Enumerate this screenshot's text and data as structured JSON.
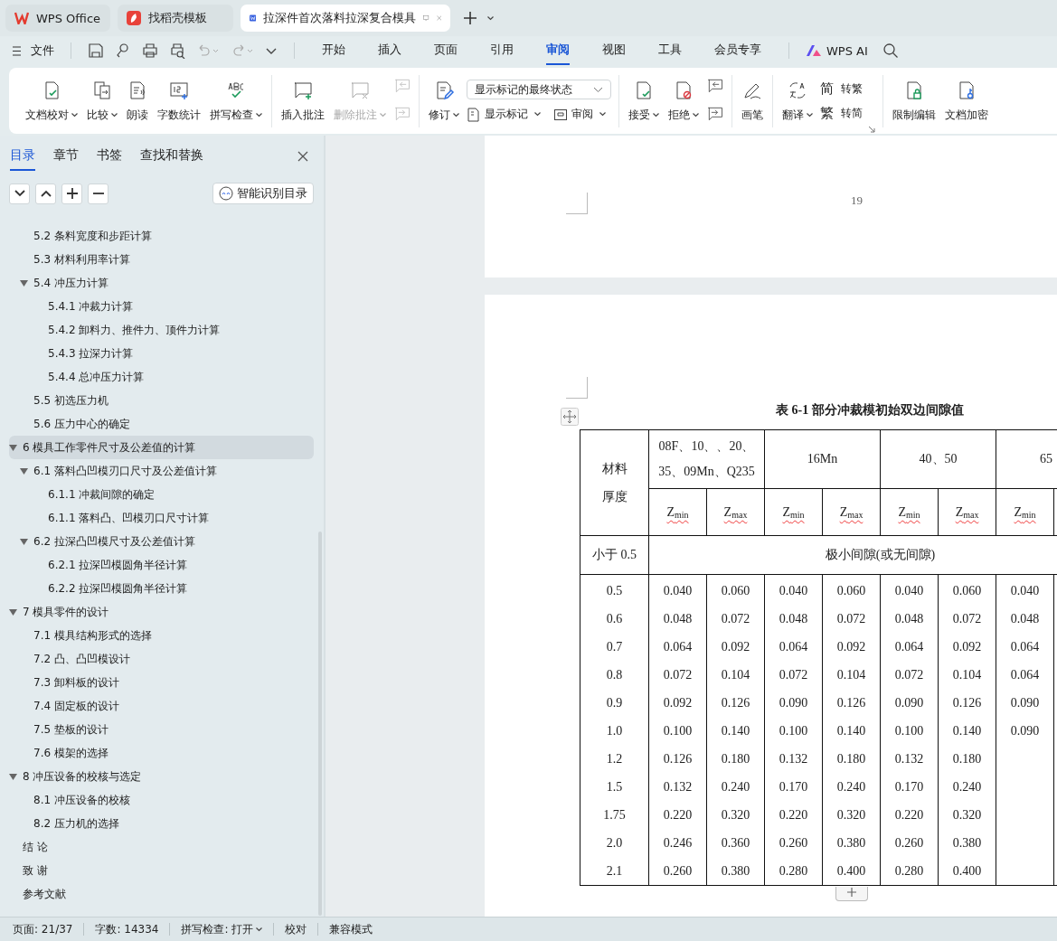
{
  "title_tabs": [
    {
      "label": "WPS Office",
      "kind": "wps",
      "selected": false,
      "closable": false
    },
    {
      "label": "找稻壳模板",
      "kind": "docer",
      "selected": false,
      "closable": false
    },
    {
      "label": "拉深件首次落料拉深复合模具",
      "kind": "doc",
      "selected": true,
      "closable": true
    }
  ],
  "file_menu": "文件",
  "menu_tabs": [
    {
      "label": "开始",
      "selected": false
    },
    {
      "label": "插入",
      "selected": false
    },
    {
      "label": "页面",
      "selected": false
    },
    {
      "label": "引用",
      "selected": false
    },
    {
      "label": "审阅",
      "selected": true
    },
    {
      "label": "视图",
      "selected": false
    },
    {
      "label": "工具",
      "selected": false
    },
    {
      "label": "会员专享",
      "selected": false
    }
  ],
  "ai_button": "WPS AI",
  "ribbon": [
    {
      "items": [
        {
          "kind": "big",
          "label": "文档校对",
          "dropdown": true,
          "disabled": false
        },
        {
          "kind": "big",
          "label": "比较",
          "dropdown": true,
          "disabled": false
        },
        {
          "kind": "big",
          "label": "朗读",
          "dropdown": false,
          "disabled": false
        },
        {
          "kind": "big",
          "label": "字数统计",
          "dropdown": false,
          "disabled": false
        },
        {
          "kind": "big",
          "label": "拼写检查",
          "dropdown": true,
          "disabled": false
        }
      ]
    },
    {
      "items": [
        {
          "kind": "big",
          "label": "插入批注",
          "dropdown": false,
          "disabled": false
        },
        {
          "kind": "big",
          "label": "删除批注",
          "dropdown": true,
          "disabled": true
        },
        {
          "kind": "icon-stack",
          "disabled": true
        }
      ]
    },
    {
      "items": [
        {
          "kind": "big",
          "label": "修订",
          "dropdown": true,
          "disabled": false
        },
        {
          "kind": "select-stack",
          "select": "显示标记的最终状态",
          "buttons": [
            {
              "label": "显示标记",
              "dropdown": true
            },
            {
              "label": "审阅",
              "dropdown": true
            }
          ]
        }
      ]
    },
    {
      "items": [
        {
          "kind": "big",
          "label": "接受",
          "dropdown": true,
          "disabled": false
        },
        {
          "kind": "big",
          "label": "拒绝",
          "dropdown": true,
          "disabled": false
        },
        {
          "kind": "icon-stack",
          "disabled": false
        }
      ]
    },
    {
      "items": [
        {
          "kind": "big",
          "label": "画笔",
          "dropdown": false,
          "disabled": false
        }
      ]
    },
    {
      "items": [
        {
          "kind": "big",
          "label": "翻译",
          "dropdown": true,
          "disabled": false
        },
        {
          "kind": "text-stack",
          "buttons": [
            {
              "glyph": "简",
              "label": "转繁"
            },
            {
              "glyph": "繁",
              "label": "转简"
            }
          ]
        }
      ]
    },
    {
      "items": [
        {
          "kind": "big",
          "label": "限制编辑",
          "dropdown": false,
          "disabled": false
        },
        {
          "kind": "big",
          "label": "文档加密",
          "dropdown": false,
          "disabled": false
        }
      ]
    }
  ],
  "sidebar": {
    "tabs": [
      {
        "label": "目录",
        "selected": true
      },
      {
        "label": "章节",
        "selected": false
      },
      {
        "label": "书签",
        "selected": false
      },
      {
        "label": "查找和替换",
        "selected": false
      }
    ],
    "smart_button": "智能识别目录",
    "outline": [
      {
        "children": [
          {
            "label": "5.2  条料宽度和步距计算",
            "selected": false
          },
          {
            "label": "5.3  材料利用率计算",
            "selected": false
          },
          {
            "label": "5.4  冲压力计算",
            "selected": false,
            "expanded": true,
            "children": [
              {
                "label": "5.4.1 冲裁力计算",
                "selected": false
              },
              {
                "label": "5.4.2 卸料力、推件力、顶件力计算",
                "selected": false
              },
              {
                "label": "5.4.3 拉深力计算",
                "selected": false
              },
              {
                "label": "5.4.4 总冲压力计算",
                "selected": false
              }
            ]
          },
          {
            "label": "5.5  初选压力机",
            "selected": false
          },
          {
            "label": "5.6 压力中心的确定",
            "selected": false
          }
        ]
      },
      {
        "label": "6  模具工作零件尺寸及公差值的计算",
        "selected": true,
        "expanded": true,
        "children": [
          {
            "label": "6.1 落料凸凹模刃口尺寸及公差值计算",
            "selected": false,
            "expanded": true,
            "children": [
              {
                "label": "6.1.1 冲裁间隙的确定",
                "selected": false
              },
              {
                "label": "6.1.1 落料凸、凹模刃口尺寸计算",
                "selected": false
              }
            ]
          },
          {
            "label": "6.2 拉深凸凹模尺寸及公差值计算",
            "selected": false,
            "expanded": true,
            "children": [
              {
                "label": "6.2.1 拉深凹模圆角半径计算",
                "selected": false
              },
              {
                "label": "6.2.2 拉深凹模圆角半径计算",
                "selected": false
              }
            ]
          }
        ]
      },
      {
        "label": "7  模具零件的设计",
        "selected": false,
        "expanded": true,
        "children": [
          {
            "label": "7.1  模具结构形式的选择",
            "selected": false
          },
          {
            "label": "7.2  凸、凸凹模设计",
            "selected": false
          },
          {
            "label": "7.3  卸料板的设计",
            "selected": false
          },
          {
            "label": "7.4  固定板的设计",
            "selected": false
          },
          {
            "label": "7.5  垫板的设计",
            "selected": false
          },
          {
            "label": "7.6  模架的选择",
            "selected": false
          }
        ]
      },
      {
        "label": "8  冲压设备的校核与选定",
        "selected": false,
        "expanded": true,
        "children": [
          {
            "label": "8.1  冲压设备的校核",
            "selected": false
          },
          {
            "label": "8.2 压力机的选择",
            "selected": false
          }
        ]
      },
      {
        "label": "结   论",
        "selected": false
      },
      {
        "label": "致   谢",
        "selected": false
      },
      {
        "label": "参考文献",
        "selected": false
      }
    ]
  },
  "document": {
    "page_number": "19",
    "table": {
      "caption": "表 6-1  部分冲裁模初始双边间隙值",
      "corner": [
        "材料",
        "厚度"
      ],
      "groups": [
        "08F、10、、20、35、09Mn、Q235",
        "16Mn",
        "40、50",
        "65"
      ],
      "subheaders": [
        "Z$_{min}$",
        "Z$_{max}$",
        "Z$_{min}$",
        "Z$_{max}$",
        "Z$_{min}$",
        "Z$_{max}$",
        "Z$_{min}$"
      ],
      "note_row": {
        "label": "小于 0.5",
        "text": "极小间隙(或无间隙)"
      },
      "rows": [
        {
          "thickness": "0.5",
          "values": [
            "0.040",
            "0.060",
            "0.040",
            "0.060",
            "0.040",
            "0.060",
            "0.040"
          ]
        },
        {
          "thickness": "0.6",
          "values": [
            "0.048",
            "0.072",
            "0.048",
            "0.072",
            "0.048",
            "0.072",
            "0.048"
          ]
        },
        {
          "thickness": "0.7",
          "values": [
            "0.064",
            "0.092",
            "0.064",
            "0.092",
            "0.064",
            "0.092",
            "0.064"
          ]
        },
        {
          "thickness": "0.8",
          "values": [
            "0.072",
            "0.104",
            "0.072",
            "0.104",
            "0.072",
            "0.104",
            "0.064"
          ]
        },
        {
          "thickness": "0.9",
          "values": [
            "0.092",
            "0.126",
            "0.090",
            "0.126",
            "0.090",
            "0.126",
            "0.090"
          ]
        },
        {
          "thickness": "1.0",
          "values": [
            "0.100",
            "0.140",
            "0.100",
            "0.140",
            "0.100",
            "0.140",
            "0.090"
          ]
        },
        {
          "thickness": "1.2",
          "values": [
            "0.126",
            "0.180",
            "0.132",
            "0.180",
            "0.132",
            "0.180"
          ]
        },
        {
          "thickness": "1.5",
          "values": [
            "0.132",
            "0.240",
            "0.170",
            "0.240",
            "0.170",
            "0.240"
          ]
        },
        {
          "thickness": "1.75",
          "values": [
            "0.220",
            "0.320",
            "0.220",
            "0.320",
            "0.220",
            "0.320"
          ]
        },
        {
          "thickness": "2.0",
          "values": [
            "0.246",
            "0.360",
            "0.260",
            "0.380",
            "0.260",
            "0.380"
          ]
        },
        {
          "thickness": "2.1",
          "values": [
            "0.260",
            "0.380",
            "0.280",
            "0.400",
            "0.280",
            "0.400"
          ]
        }
      ]
    }
  },
  "status_bar": [
    {
      "kind": "text",
      "label": "页面: 21/37"
    },
    {
      "kind": "text",
      "label": "字数: 14334"
    },
    {
      "kind": "dropdown",
      "label": "拼写检查: 打开"
    },
    {
      "kind": "button",
      "label": "校对"
    },
    {
      "kind": "text",
      "label": "兼容模式"
    }
  ]
}
